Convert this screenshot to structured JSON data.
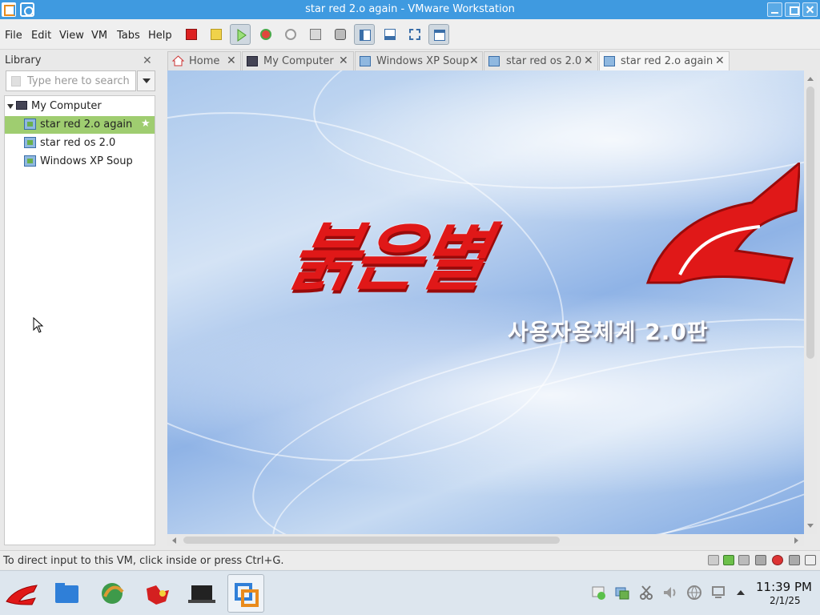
{
  "window": {
    "title": "star red 2.o again - VMware Workstation"
  },
  "menu": [
    "File",
    "Edit",
    "View",
    "VM",
    "Tabs",
    "Help"
  ],
  "toolbar": {
    "icons": [
      "power-off-icon",
      "suspend-icon",
      "play-icon",
      "snapshot-icon",
      "revert-icon",
      "snapshot-manager-icon",
      "capture-icon",
      "library-view-icon",
      "thumbnail-bar-icon",
      "fullscreen-icon",
      "unity-icon"
    ]
  },
  "library": {
    "title": "Library",
    "search_placeholder": "Type here to search",
    "root": "My Computer",
    "items": [
      {
        "label": "star red 2.o again",
        "selected": true,
        "favorite": true
      },
      {
        "label": "star red os 2.0",
        "selected": false
      },
      {
        "label": "Windows XP Soup",
        "selected": false
      }
    ]
  },
  "tabs": [
    {
      "label": "Home",
      "icon": "home-icon"
    },
    {
      "label": "My Computer",
      "icon": "computer-icon"
    },
    {
      "label": "Windows XP Soup",
      "icon": "vm-icon"
    },
    {
      "label": "star red os 2.0",
      "icon": "vm-icon"
    },
    {
      "label": "star red 2.o again",
      "icon": "vm-icon",
      "active": true
    }
  ],
  "vm": {
    "logo_text": "붉은별",
    "subtitle": "사용자용체계 2.0판"
  },
  "status": {
    "text": "To direct input to this VM, click inside or press Ctrl+G."
  },
  "taskbar": {
    "apps": [
      "start-menu-icon",
      "file-manager-icon",
      "browser-icon",
      "app-icon",
      "terminal-icon",
      "vmware-icon"
    ],
    "time": "11:39 PM",
    "date": "2/1/25"
  },
  "colors": {
    "titlebar": "#3f9ae0",
    "selected": "#9fcd70",
    "logo_red": "#e01818"
  }
}
